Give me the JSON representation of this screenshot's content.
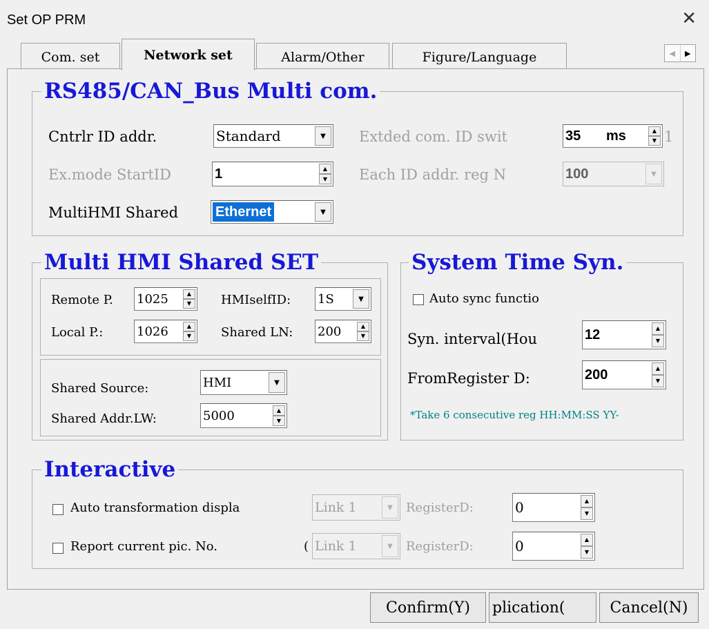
{
  "window": {
    "title": "Set OP PRM"
  },
  "tabs": [
    "Com. set",
    "Network set",
    "Alarm/Other",
    "Figure/Language"
  ],
  "multicom": {
    "title": "RS485/CAN_Bus Multi com.",
    "cntrlr_label": "Cntrlr ID addr.",
    "cntrlr_value": "Standard",
    "extded_label": "Extded com. ID swit",
    "extded_value": "35",
    "extded_unit": "ms",
    "extded_trail": "1",
    "exmode_label": "Ex.mode StartID",
    "exmode_value": "1",
    "eachid_label": "Each ID addr. reg N",
    "eachid_value": "100",
    "multihmi_label": "MultiHMI Shared",
    "multihmi_value": "Ethernet"
  },
  "shared": {
    "title": "Multi HMI Shared SET",
    "remote_label": "Remote P.",
    "remote_value": "1025",
    "selfid_label": "HMIselfID:",
    "selfid_value": "1S",
    "local_label": "Local P.:",
    "local_value": "1026",
    "shared_ln_label": "Shared LN:",
    "shared_ln_value": "200",
    "source_label": "Shared Source:",
    "source_value": "HMI",
    "addr_label": "Shared Addr.LW:",
    "addr_value": "5000"
  },
  "timesyn": {
    "title": "System Time Syn.",
    "auto_label": "Auto sync functio",
    "interval_label": "Syn. interval(Hou",
    "interval_value": "12",
    "fromreg_label": "FromRegister D:",
    "fromreg_value": "200",
    "note": "*Take 6 consecutive reg HH:MM:SS YY-"
  },
  "interactive": {
    "title": "Interactive",
    "row1_label": "Auto transformation displa",
    "row1_link": "Link 1",
    "row1_reg_label": "RegisterD:",
    "row1_reg_value": "0",
    "row2_label": "Report current pic. No.",
    "row2_paren": "(",
    "row2_link": "Link 1",
    "row2_reg_label": "RegisterD:",
    "row2_reg_value": "0"
  },
  "buttons": {
    "confirm": "Confirm(Y)",
    "application": "plication(",
    "cancel": "Cancel(N)"
  }
}
